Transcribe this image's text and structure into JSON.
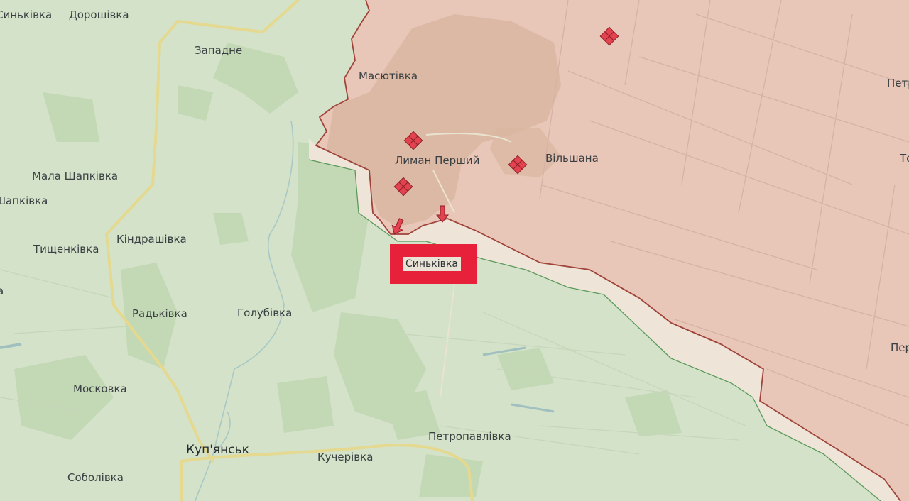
{
  "map": {
    "colors": {
      "controlled_area": "#e8c6b8",
      "grey_zone": "#eee5d8",
      "free_area": "#d3e2c8",
      "frontline": "#a0433a",
      "attack_marker": "#e2434f",
      "highlight": "#e8213a"
    },
    "places": [
      {
        "id": "syn",
        "name": "Синьківка",
        "highlighted": true
      },
      {
        "id": "dorosh",
        "name": "Дорошівка"
      },
      {
        "id": "sinkivka_tl",
        "name": "Синьківка"
      },
      {
        "id": "zapadne",
        "name": "Западне"
      },
      {
        "id": "masyut",
        "name": "Масютівка"
      },
      {
        "id": "lyman",
        "name": "Лиман Перший"
      },
      {
        "id": "vilsh",
        "name": "Вільшана"
      },
      {
        "id": "mshap",
        "name": "Мала Шапківка"
      },
      {
        "id": "shap",
        "name": "Шапківка"
      },
      {
        "id": "kindr",
        "name": "Кіндрашівка"
      },
      {
        "id": "tysch",
        "name": "Тищенківка"
      },
      {
        "id": "radk",
        "name": "Радьківка"
      },
      {
        "id": "holub",
        "name": "Голубівка"
      },
      {
        "id": "mosk",
        "name": "Московка"
      },
      {
        "id": "petrop",
        "name": "Петропавлівка"
      },
      {
        "id": "kupyansk",
        "name": "Куп'янськ"
      },
      {
        "id": "kuch",
        "name": "Кучерівка"
      },
      {
        "id": "sobol",
        "name": "Соболівка"
      },
      {
        "id": "petr1",
        "name": "Петр"
      },
      {
        "id": "petr2",
        "name": "Пер"
      },
      {
        "id": "t",
        "name": "То"
      },
      {
        "id": "a",
        "name": "а"
      }
    ],
    "markers": {
      "attack_icon": "diamond-grid-icon",
      "arrow_icon": "arrow-down-icon"
    }
  }
}
